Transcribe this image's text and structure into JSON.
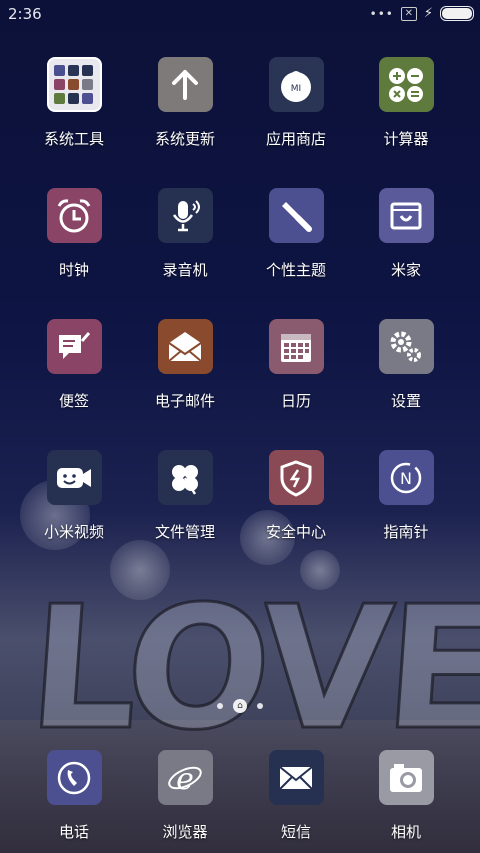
{
  "status_bar": {
    "time": "2:36",
    "signal_dots": "•••",
    "sim_icon": "sim-missing-icon",
    "charging_icon": "lightning-icon",
    "battery_icon": "battery-icon"
  },
  "apps": [
    {
      "label": "系统工具",
      "icon": "folder-icon",
      "color": "#ffffff"
    },
    {
      "label": "系统更新",
      "icon": "arrow-up-icon",
      "color": "#7f7a7a"
    },
    {
      "label": "应用商店",
      "icon": "mi-store-icon",
      "color": "#2a3555"
    },
    {
      "label": "计算器",
      "icon": "calculator-icon",
      "color": "#5f7a3d"
    },
    {
      "label": "时钟",
      "icon": "alarm-clock-icon",
      "color": "#8a4466"
    },
    {
      "label": "录音机",
      "icon": "microphone-icon",
      "color": "#263050"
    },
    {
      "label": "个性主题",
      "icon": "brush-icon",
      "color": "#4c4f90"
    },
    {
      "label": "米家",
      "icon": "home-device-icon",
      "color": "#5a5a9a"
    },
    {
      "label": "便签",
      "icon": "note-icon",
      "color": "#8a4466"
    },
    {
      "label": "电子邮件",
      "icon": "envelope-open-icon",
      "color": "#8a4a2e"
    },
    {
      "label": "日历",
      "icon": "calendar-icon",
      "color": "#8a5a6e"
    },
    {
      "label": "设置",
      "icon": "gear-icon",
      "color": "#7a7a86"
    },
    {
      "label": "小米视频",
      "icon": "video-camera-icon",
      "color": "#263050"
    },
    {
      "label": "文件管理",
      "icon": "clover-icon",
      "color": "#263050"
    },
    {
      "label": "安全中心",
      "icon": "shield-icon",
      "color": "#8a4a55"
    },
    {
      "label": "指南针",
      "icon": "compass-icon",
      "color": "#4c4f90"
    }
  ],
  "dock": [
    {
      "label": "电话",
      "icon": "phone-icon",
      "color": "#4c4f90"
    },
    {
      "label": "浏览器",
      "icon": "browser-icon",
      "color": "#7a7a86"
    },
    {
      "label": "短信",
      "icon": "envelope-icon",
      "color": "#263050"
    },
    {
      "label": "相机",
      "icon": "camera-icon",
      "color": "#9a9aa4"
    }
  ],
  "page_indicator": {
    "pages": 3,
    "current": 2
  }
}
